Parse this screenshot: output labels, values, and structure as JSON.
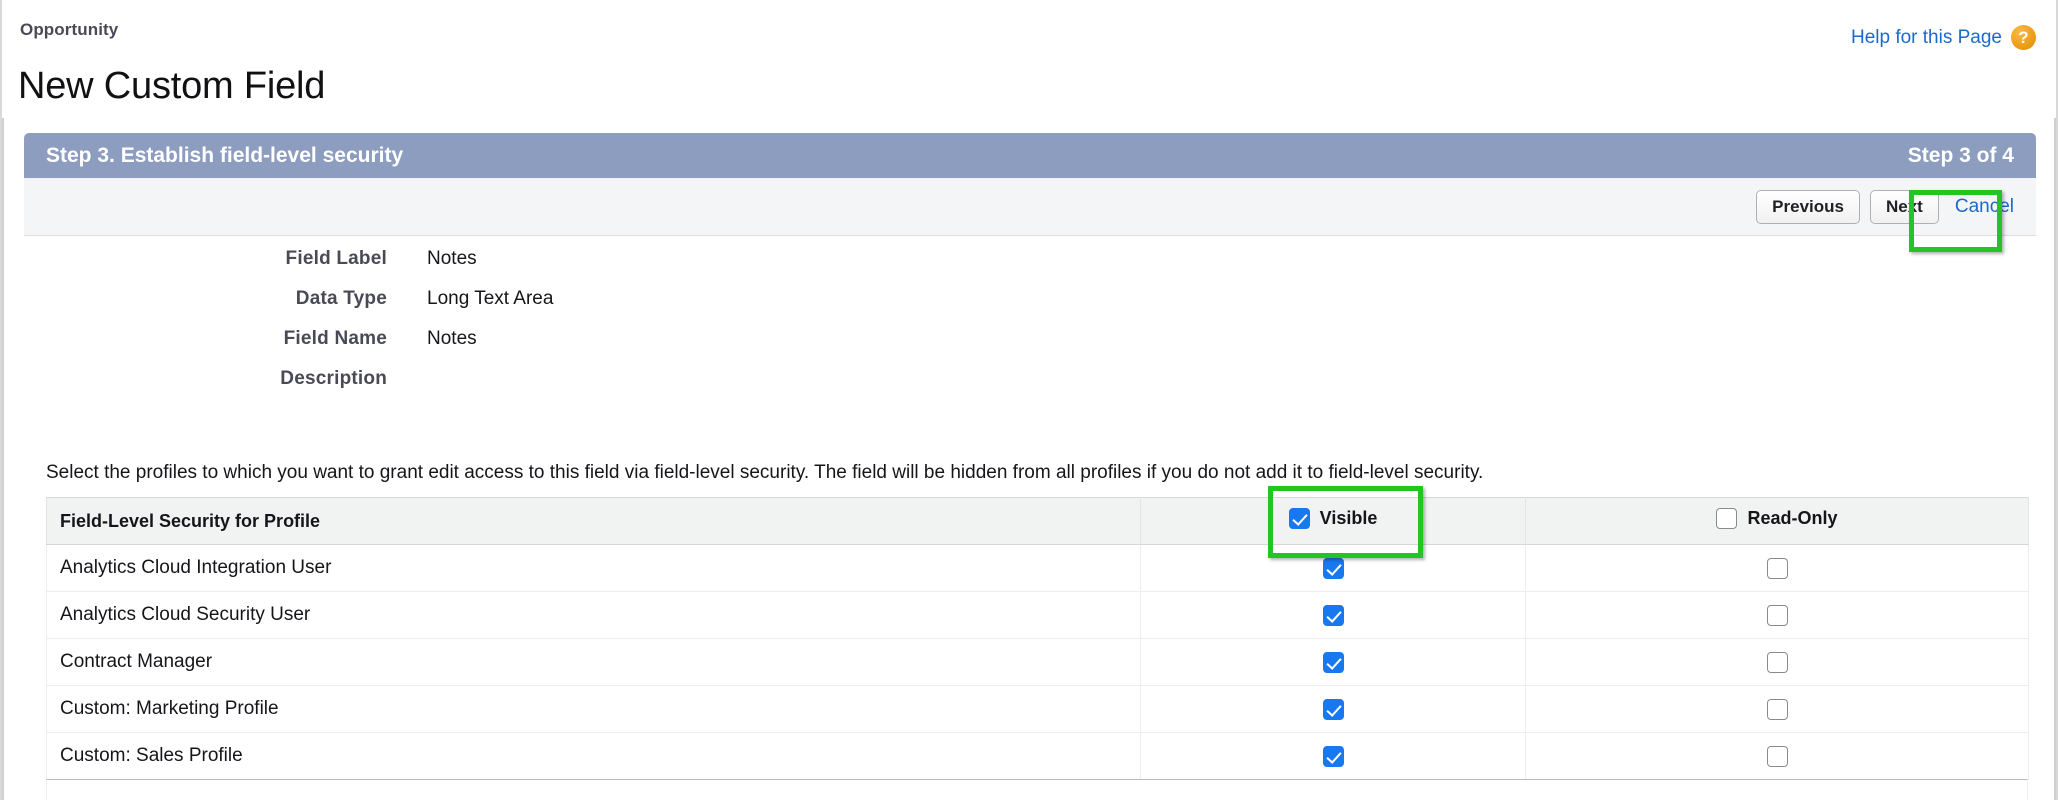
{
  "header": {
    "breadcrumb": "Opportunity",
    "title": "New Custom Field",
    "help_link": "Help for this Page",
    "help_icon_glyph": "?"
  },
  "step": {
    "title": "Step 3. Establish field-level security",
    "counter": "Step 3 of 4"
  },
  "actions": {
    "previous_label": "Previous",
    "next_label": "Next",
    "cancel_label": "Cancel"
  },
  "field_summary": [
    {
      "label": "Field Label",
      "value": "Notes"
    },
    {
      "label": "Data Type",
      "value": "Long Text Area"
    },
    {
      "label": "Field Name",
      "value": "Notes"
    },
    {
      "label": "Description",
      "value": ""
    }
  ],
  "instruction": "Select the profiles to which you want to grant edit access to this field via field-level security. The field will be hidden from all profiles if you do not add it to field-level security.",
  "table": {
    "headers": {
      "profile": "Field-Level Security for Profile",
      "visible": "Visible",
      "read_only": "Read-Only"
    },
    "header_checkboxes": {
      "visible_checked": true,
      "read_only_checked": false
    },
    "rows": [
      {
        "profile": "Analytics Cloud Integration User",
        "visible": true,
        "read_only": false
      },
      {
        "profile": "Analytics Cloud Security User",
        "visible": true,
        "read_only": false
      },
      {
        "profile": "Contract Manager",
        "visible": true,
        "read_only": false
      },
      {
        "profile": "Custom: Marketing Profile",
        "visible": true,
        "read_only": false
      },
      {
        "profile": "Custom: Sales Profile",
        "visible": true,
        "read_only": false
      }
    ]
  },
  "highlights": {
    "color": "#22c522",
    "targets": [
      "next-button",
      "visible-column-header"
    ]
  }
}
